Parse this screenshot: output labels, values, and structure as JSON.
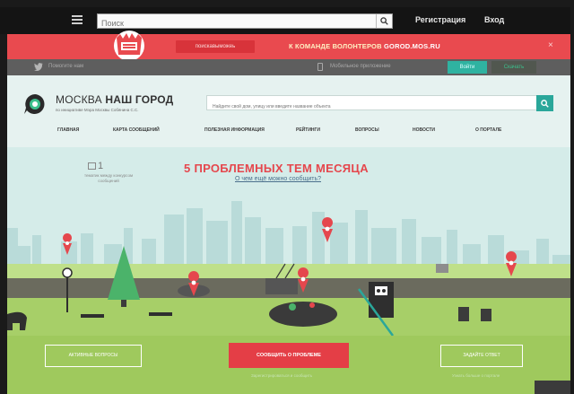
{
  "topbar": {
    "search_placeholder": "Поиск",
    "register_label": "Регистрация",
    "login_label": "Вход"
  },
  "banner": {
    "button_label": "поискавыможеь",
    "text": "К КОМАНДЕ ВОЛОНТЕРОВ",
    "link": "GOROD.MOS.RU",
    "close": "×"
  },
  "socialbar": {
    "twitter_text": "Помогите нам",
    "phone_text": "Мобильное приложение",
    "button1_label": "Войти",
    "button2_label": "Скачать"
  },
  "site": {
    "title_light": "МОСКВА",
    "title_bold": "НАШ ГОРОД",
    "subtitle": "по инициативе Мэра Москвы Собянина С.С.",
    "search_placeholder": "Найдите свой дом, улицу или введите название объекта"
  },
  "nav": {
    "items": [
      {
        "label": "Главная"
      },
      {
        "label": "Карта сообщений"
      },
      {
        "label": "Полезная информация"
      },
      {
        "label": "Рейтинги"
      },
      {
        "label": "Вопросы"
      },
      {
        "label": "Новости"
      },
      {
        "label": "О портале"
      }
    ]
  },
  "counter": {
    "value": "1",
    "label": "тематик между конкурсом сообщений"
  },
  "headline": {
    "title": "5 ПРОБЛЕМНЫХ ТЕМ МЕСЯЦА",
    "link": "О чем ещё можно сообщить?"
  },
  "cta": {
    "left_label": "активные вопросы",
    "main_label": "сообщить о проблеме",
    "main_sub": "Зарегистрироваться и сообщить",
    "right_label": "задайте ответ",
    "right_sub": "Узнать больше о портале"
  },
  "colors": {
    "accent_red": "#e5474d",
    "accent_teal": "#2aa79a",
    "sky": "#d5ece9",
    "grass": "#a7cf68"
  }
}
